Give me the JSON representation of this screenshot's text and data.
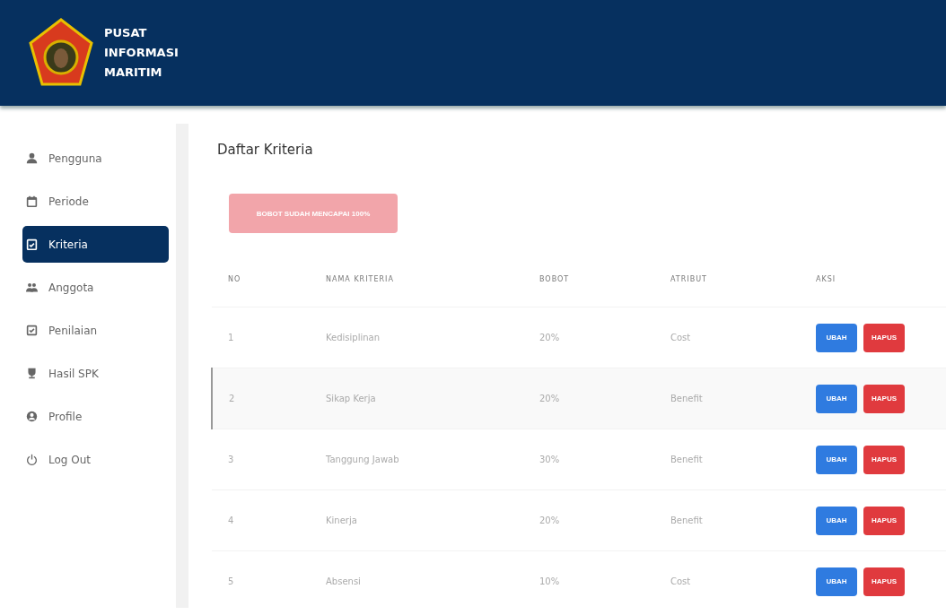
{
  "header": {
    "title_lines": [
      "PUSAT",
      "INFORMASI",
      "MARITIM"
    ]
  },
  "sidebar": {
    "items": [
      {
        "label": "Pengguna",
        "selected": false
      },
      {
        "label": "Periode",
        "selected": false
      },
      {
        "label": "Kriteria",
        "selected": true
      },
      {
        "label": "Anggota",
        "selected": false
      },
      {
        "label": "Penilaian",
        "selected": false
      },
      {
        "label": "Hasil SPK",
        "selected": false
      },
      {
        "label": "Profile",
        "selected": false
      },
      {
        "label": "Log Out",
        "selected": false
      }
    ]
  },
  "page_title": "Daftar Kriteria",
  "status_button": {
    "label": "BOBOT SUDAH MENCAPAI 100%",
    "disabled": true
  },
  "table": {
    "columns": [
      "NO",
      "NAMA KRITERIA",
      "BOBOT",
      "ATRIBUT",
      "AKSI"
    ],
    "rows": [
      {
        "no": "1",
        "name": "Kedisiplinan",
        "weight": "20%",
        "attribute": "Cost",
        "highlighted": false,
        "actions": [
          "UBAH",
          "HAPUS"
        ]
      },
      {
        "no": "2",
        "name": "Sikap Kerja",
        "weight": "20%",
        "attribute": "Benefit",
        "highlighted": true,
        "actions": [
          "UBAH",
          "HAPUS"
        ]
      },
      {
        "no": "3",
        "name": "Tanggung Jawab",
        "weight": "30%",
        "attribute": "Benefit",
        "highlighted": false,
        "actions": [
          "UBAH",
          "HAPUS"
        ]
      },
      {
        "no": "4",
        "name": "Kinerja",
        "weight": "20%",
        "attribute": "Benefit",
        "highlighted": false,
        "actions": [
          "UBAH",
          "HAPUS"
        ]
      },
      {
        "no": "5",
        "name": "Absensi",
        "weight": "10%",
        "attribute": "Cost",
        "highlighted": false,
        "actions": [
          "UBAH",
          "HAPUS"
        ]
      }
    ]
  }
}
